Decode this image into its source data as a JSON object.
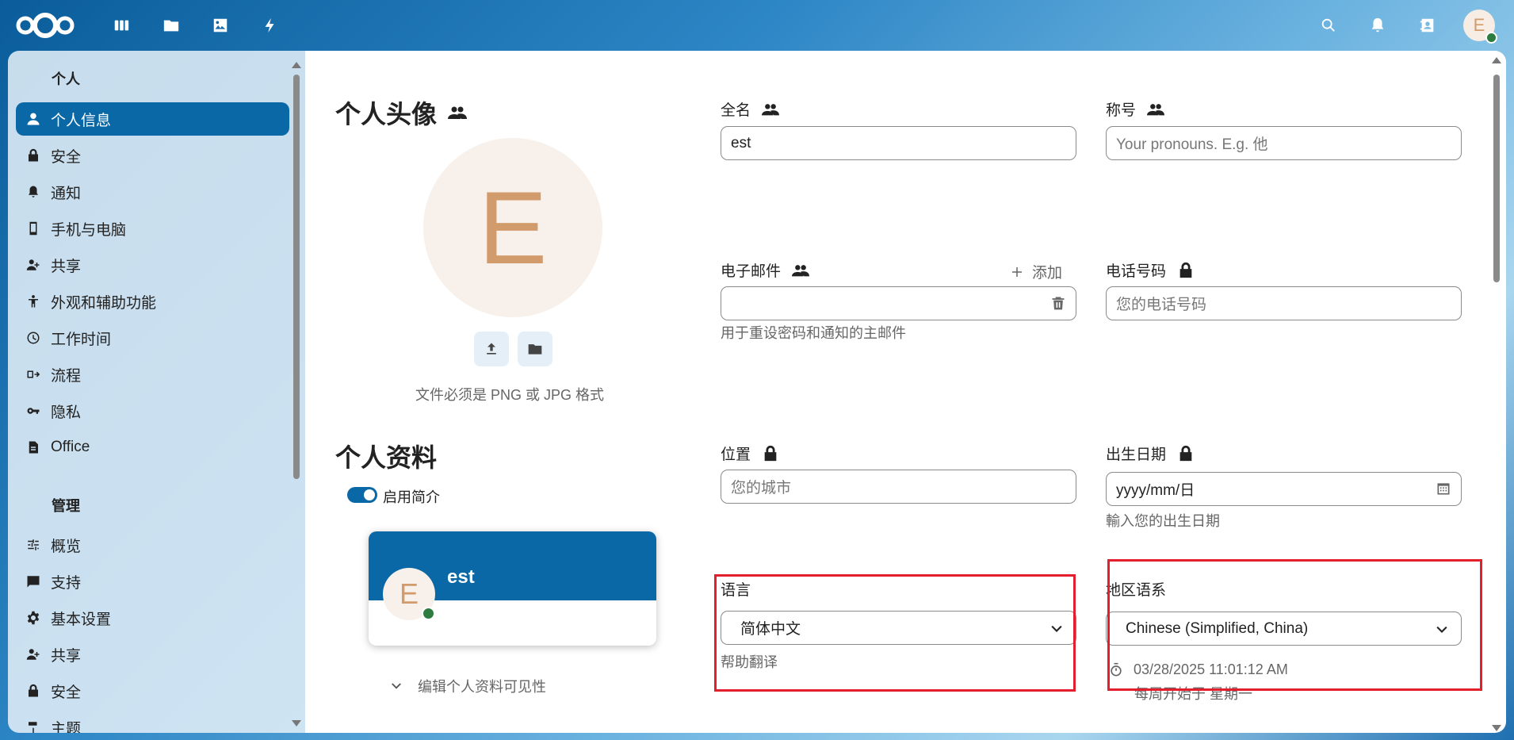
{
  "topbar": {
    "apps": [
      "dashboard-icon",
      "files-icon",
      "photos-icon",
      "activity-icon"
    ],
    "right": [
      "search-icon",
      "bell-icon",
      "contacts-icon"
    ],
    "avatar_letter": "E"
  },
  "sidebar": {
    "heading_personal": "个人",
    "personal_items": [
      {
        "label": "个人信息",
        "icon": "user-icon",
        "active": true
      },
      {
        "label": "安全",
        "icon": "lock-icon"
      },
      {
        "label": "通知",
        "icon": "bell-icon"
      },
      {
        "label": "手机与电脑",
        "icon": "phone-icon"
      },
      {
        "label": "共享",
        "icon": "share-icon"
      },
      {
        "label": "外观和辅助功能",
        "icon": "accessibility-icon"
      },
      {
        "label": "工作时间",
        "icon": "clock-icon"
      },
      {
        "label": "流程",
        "icon": "flow-icon"
      },
      {
        "label": "隐私",
        "icon": "key-icon"
      },
      {
        "label": "Office",
        "icon": "document-icon"
      }
    ],
    "heading_admin": "管理",
    "admin_items": [
      {
        "label": "概览",
        "icon": "sliders-icon"
      },
      {
        "label": "支持",
        "icon": "chat-icon"
      },
      {
        "label": "基本设置",
        "icon": "gear-icon"
      },
      {
        "label": "共享",
        "icon": "share-icon"
      },
      {
        "label": "安全",
        "icon": "lock-icon"
      },
      {
        "label": "主题",
        "icon": "theme-icon"
      }
    ]
  },
  "main": {
    "avatar_section": {
      "title": "个人头像",
      "letter": "E",
      "hint": "文件必须是 PNG 或 JPG 格式"
    },
    "profile_section": {
      "title": "个人资料",
      "toggle_label": "启用简介",
      "card_name": "est",
      "card_letter": "E",
      "visibility_label": "编辑个人资料可见性"
    },
    "fields": {
      "fullname": {
        "label": "全名",
        "value": "est"
      },
      "pronouns": {
        "label": "称号",
        "placeholder": "Your pronouns. E.g. 他"
      },
      "email": {
        "label": "电子邮件",
        "add_label": "添加",
        "value": "",
        "hint": "用于重设密码和通知的主邮件"
      },
      "phone": {
        "label": "电话号码",
        "placeholder": "您的电话号码"
      },
      "location": {
        "label": "位置",
        "placeholder": "您的城市"
      },
      "birthday": {
        "label": "出生日期",
        "placeholder": "yyyy/mm/日",
        "hint": "輸入您的出生日期"
      },
      "language": {
        "label": "语言",
        "value": "简体中文",
        "hint": "帮助翻译"
      },
      "locale": {
        "label": "地区语系",
        "value": "Chinese (Simplified, China)",
        "time": "03/28/2025 11:01:12 AM",
        "week_start": "每周开始于 星期一"
      }
    }
  }
}
